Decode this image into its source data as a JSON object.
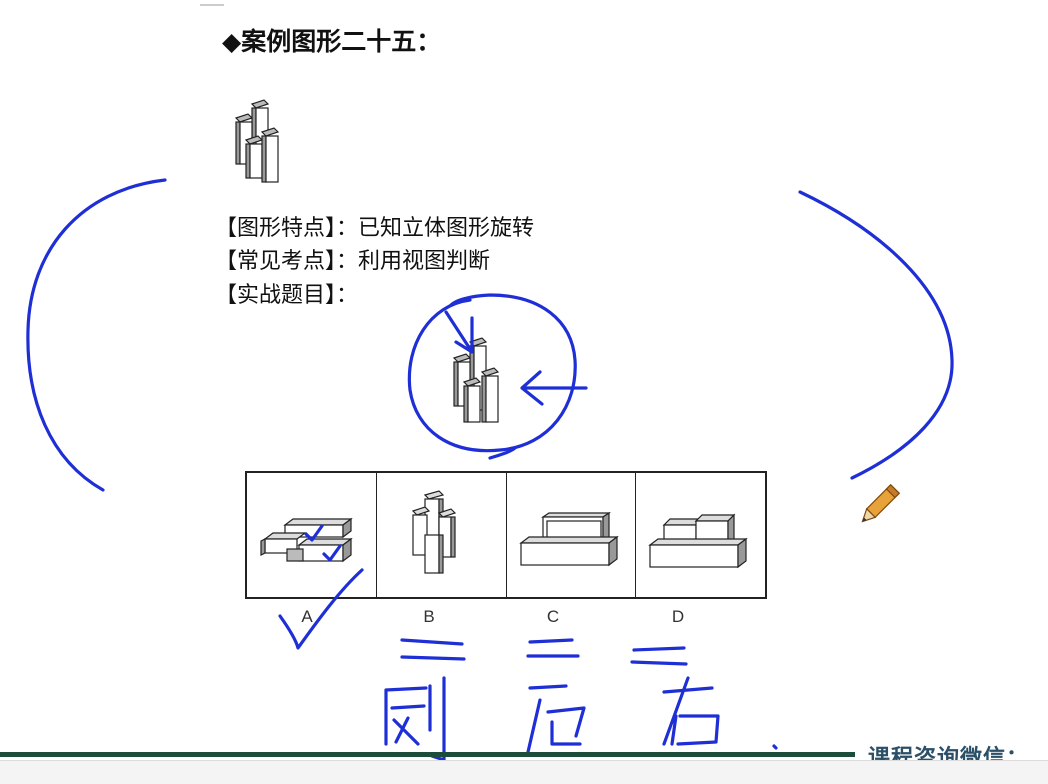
{
  "title": "◆案例图形二十五：",
  "info": {
    "feature_label": "【图形特点】：",
    "feature_value": "已知立体图形旋转",
    "exam_label": "【常见考点】：",
    "exam_value": "利用视图判断",
    "practice_label": "【实战题目】："
  },
  "options": [
    "A",
    "B",
    "C",
    "D"
  ],
  "footer_text": "课程咨询微信：",
  "colors": {
    "ink": "#1f2fd6",
    "footer_bar": "#1b4d3a",
    "footer_text": "#2a4f66"
  },
  "icons": [
    "pencil-icon"
  ]
}
